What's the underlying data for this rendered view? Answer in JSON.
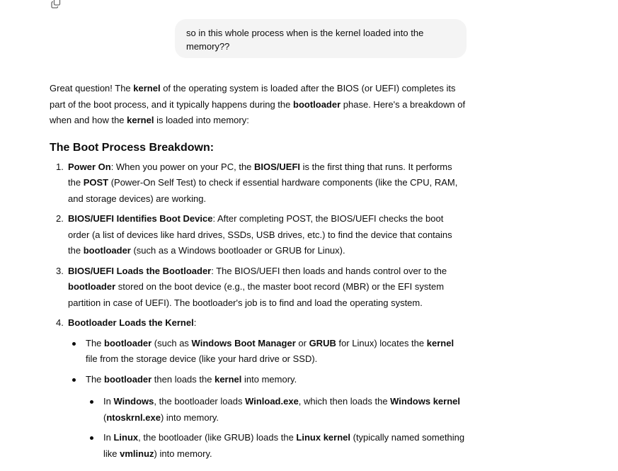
{
  "icons": {
    "copy": "copy-icon"
  },
  "user_message": "so in this whole process when is the kernel loaded into the memory??",
  "answer": {
    "intro": {
      "t1": "Great question! The ",
      "b1": "kernel",
      "t2": " of the operating system is loaded after the BIOS (or UEFI) completes its part of the boot process, and it typically happens during the ",
      "b2": "bootloader",
      "t3": " phase. Here's a breakdown of when and how the ",
      "b3": "kernel",
      "t4": " is loaded into memory:"
    },
    "heading": "The Boot Process Breakdown:",
    "steps": [
      {
        "num": "1.",
        "b1": "Power On",
        "t1": ": When you power on your PC, the ",
        "b2": "BIOS/UEFI",
        "t2": " is the first thing that runs. It performs the ",
        "b3": "POST",
        "t3": " (Power-On Self Test) to check if essential hardware components (like the CPU, RAM, and storage devices) are working."
      },
      {
        "num": "2.",
        "b1": "BIOS/UEFI Identifies Boot Device",
        "t1": ": After completing POST, the BIOS/UEFI checks the boot order (a list of devices like hard drives, SSDs, USB drives, etc.) to find the device that contains the ",
        "b2": "bootloader",
        "t2": " (such as a Windows bootloader or GRUB for Linux)."
      },
      {
        "num": "3.",
        "b1": "BIOS/UEFI Loads the Bootloader",
        "t1": ": The BIOS/UEFI then loads and hands control over to the ",
        "b2": "bootloader",
        "t2": " stored on the boot device (e.g., the master boot record (MBR) or the EFI system partition in case of UEFI). The bootloader's job is to find and load the operating system."
      },
      {
        "num": "4.",
        "b1": "Bootloader Loads the Kernel",
        "t1": ":",
        "bullets": [
          {
            "t1": "The ",
            "b1": "bootloader",
            "t2": " (such as ",
            "b2": "Windows Boot Manager",
            "t3": " or ",
            "b3": "GRUB",
            "t4": " for Linux) locates the ",
            "b4": "kernel",
            "t5": " file from the storage device (like your hard drive or SSD)."
          },
          {
            "t1": "The ",
            "b1": "bootloader",
            "t2": " then loads the ",
            "b2": "kernel",
            "t3": " into memory.",
            "sub": [
              {
                "t1": "In ",
                "b1": "Windows",
                "t2": ", the bootloader loads ",
                "b2": "Winload.exe",
                "t3": ", which then loads the ",
                "b3": "Windows kernel",
                "t4": " (",
                "b4": "ntoskrnl.exe",
                "t5": ") into memory."
              },
              {
                "t1": "In ",
                "b1": "Linux",
                "t2": ", the bootloader (like GRUB) loads the ",
                "b2": "Linux kernel",
                "t3": " (typically named something like ",
                "b3": "vmlinuz",
                "t4": ") into memory."
              }
            ]
          }
        ]
      }
    ]
  }
}
